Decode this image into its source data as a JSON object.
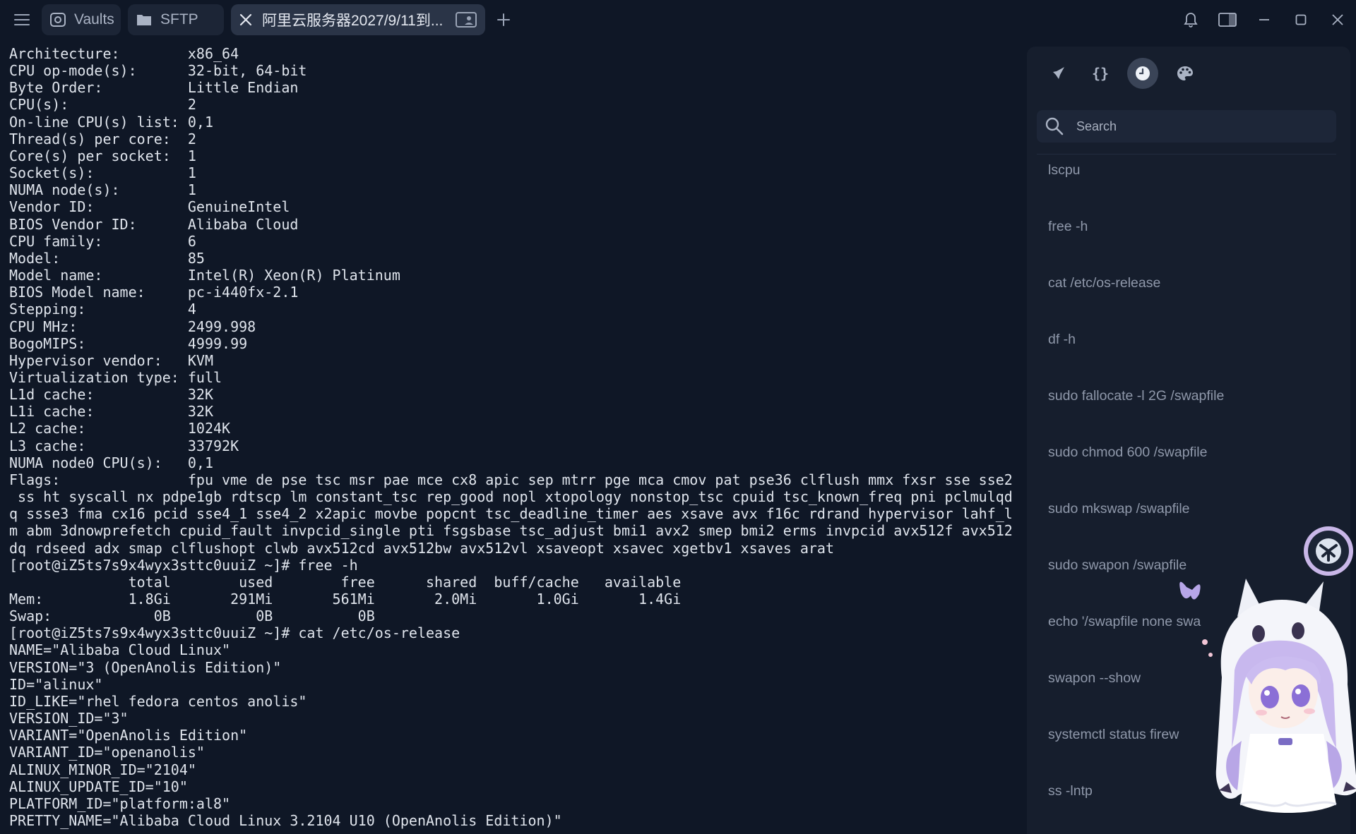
{
  "topbar": {
    "menu_icon": "hamburger-icon",
    "tabs": [
      {
        "label": "Vaults",
        "icon": "vault-icon"
      },
      {
        "label": "SFTP",
        "icon": "folder-icon"
      },
      {
        "label": "阿里云服务器2027/9/11到...",
        "icon": "close-icon",
        "tail_icon": "terminal-user-icon"
      }
    ],
    "new_tab_icon": "plus-icon",
    "controls": [
      "bell-icon",
      "split-panel-icon",
      "minimize-icon",
      "maximize-icon",
      "close-icon"
    ]
  },
  "terminal": {
    "lines": [
      "Architecture:        x86_64",
      "CPU op-mode(s):      32-bit, 64-bit",
      "Byte Order:          Little Endian",
      "CPU(s):              2",
      "On-line CPU(s) list: 0,1",
      "Thread(s) per core:  2",
      "Core(s) per socket:  1",
      "Socket(s):           1",
      "NUMA node(s):        1",
      "Vendor ID:           GenuineIntel",
      "BIOS Vendor ID:      Alibaba Cloud",
      "CPU family:          6",
      "Model:               85",
      "Model name:          Intel(R) Xeon(R) Platinum",
      "BIOS Model name:     pc-i440fx-2.1",
      "Stepping:            4",
      "CPU MHz:             2499.998",
      "BogoMIPS:            4999.99",
      "Hypervisor vendor:   KVM",
      "Virtualization type: full",
      "L1d cache:           32K",
      "L1i cache:           32K",
      "L2 cache:            1024K",
      "L3 cache:            33792K",
      "NUMA node0 CPU(s):   0,1",
      "Flags:               fpu vme de pse tsc msr pae mce cx8 apic sep mtrr pge mca cmov pat pse36 clflush mmx fxsr sse sse2",
      " ss ht syscall nx pdpe1gb rdtscp lm constant_tsc rep_good nopl xtopology nonstop_tsc cpuid tsc_known_freq pni pclmulqd",
      "q ssse3 fma cx16 pcid sse4_1 sse4_2 x2apic movbe popcnt tsc_deadline_timer aes xsave avx f16c rdrand hypervisor lahf_l",
      "m abm 3dnowprefetch cpuid_fault invpcid_single pti fsgsbase tsc_adjust bmi1 avx2 smep bmi2 erms invpcid avx512f avx512",
      "dq rdseed adx smap clflushopt clwb avx512cd avx512bw avx512vl xsaveopt xsavec xgetbv1 xsaves arat",
      "[root@iZ5ts7s9x4wyx3sttc0uuiZ ~]# free -h",
      "              total        used        free      shared  buff/cache   available",
      "Mem:          1.8Gi       291Mi       561Mi       2.0Mi       1.0Gi       1.4Gi",
      "Swap:            0B          0B          0B",
      "[root@iZ5ts7s9x4wyx3sttc0uuiZ ~]# cat /etc/os-release",
      "NAME=\"Alibaba Cloud Linux\"",
      "VERSION=\"3 (OpenAnolis Edition)\"",
      "ID=\"alinux\"",
      "ID_LIKE=\"rhel fedora centos anolis\"",
      "VERSION_ID=\"3\"",
      "VARIANT=\"OpenAnolis Edition\"",
      "VARIANT_ID=\"openanolis\"",
      "ALINUX_MINOR_ID=\"2104\"",
      "ALINUX_UPDATE_ID=\"10\"",
      "PLATFORM_ID=\"platform:al8\"",
      "PRETTY_NAME=\"Alibaba Cloud Linux 3.2104 U10 (OpenAnolis Edition)\""
    ]
  },
  "side_panel": {
    "tabs": [
      {
        "icon": "rocket-icon",
        "active": false
      },
      {
        "icon": "braces-icon",
        "active": false
      },
      {
        "icon": "history-clock-icon",
        "active": true
      },
      {
        "icon": "palette-icon",
        "active": false
      }
    ],
    "search": {
      "placeholder": "Search",
      "value": ""
    },
    "history": [
      "lscpu",
      "free -h",
      "cat /etc/os-release",
      "df -h",
      "sudo fallocate -l 2G /swapfile",
      "sudo chmod 600 /swapfile",
      "sudo mkswap /swapfile",
      "sudo swapon /swapfile",
      "echo '/swapfile none swa",
      "swapon --show",
      "systemctl status firew",
      "ss -lntp"
    ]
  },
  "colors": {
    "background": "#0f1726",
    "panel": "#161e2d",
    "tab_active": "#2a3447",
    "text": "#dfe4ec",
    "muted": "#8f98aa"
  }
}
